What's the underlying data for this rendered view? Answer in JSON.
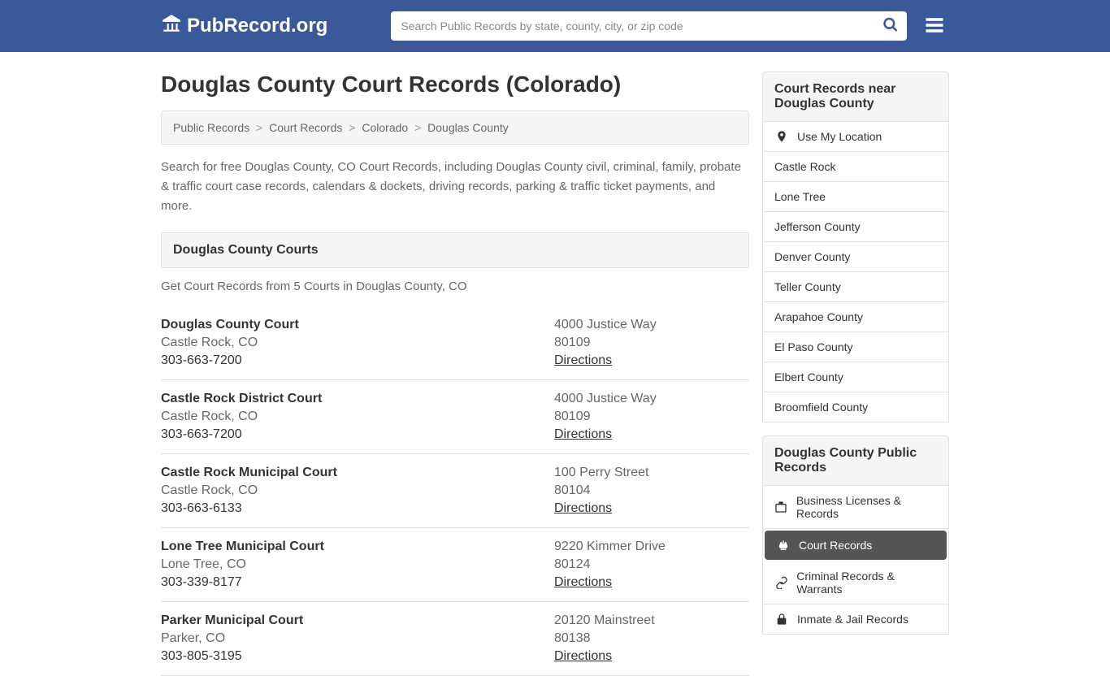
{
  "header": {
    "logo_text": "PubRecord.org",
    "search_placeholder": "Search Public Records by state, county, city, or zip code"
  },
  "page_title": "Douglas County Court Records (Colorado)",
  "breadcrumb": {
    "items": [
      "Public Records",
      "Court Records",
      "Colorado"
    ],
    "current": "Douglas County"
  },
  "intro": "Search for free Douglas County, CO Court Records, including Douglas County civil, criminal, family, probate & traffic court case records, calendars & dockets, driving records, parking & traffic ticket payments, and more.",
  "courts_section": {
    "header": "Douglas County Courts",
    "subtext": "Get Court Records from 5 Courts in Douglas County, CO",
    "directions_label": "Directions",
    "items": [
      {
        "name": "Douglas County Court",
        "location": "Castle Rock, CO",
        "phone": "303-663-7200",
        "address": "4000 Justice Way",
        "zip": "80109"
      },
      {
        "name": "Castle Rock District Court",
        "location": "Castle Rock, CO",
        "phone": "303-663-7200",
        "address": "4000 Justice Way",
        "zip": "80109"
      },
      {
        "name": "Castle Rock Municipal Court",
        "location": "Castle Rock, CO",
        "phone": "303-663-6133",
        "address": "100 Perry Street",
        "zip": "80104"
      },
      {
        "name": "Lone Tree Municipal Court",
        "location": "Lone Tree, CO",
        "phone": "303-339-8177",
        "address": "9220 Kimmer Drive",
        "zip": "80124"
      },
      {
        "name": "Parker Municipal Court",
        "location": "Parker, CO",
        "phone": "303-805-3195",
        "address": "20120 Mainstreet",
        "zip": "80138"
      }
    ]
  },
  "sidebar_near": {
    "header": "Court Records near Douglas County",
    "use_location": "Use My Location",
    "items": [
      "Castle Rock",
      "Lone Tree",
      "Jefferson County",
      "Denver County",
      "Teller County",
      "Arapahoe County",
      "El Paso County",
      "Elbert County",
      "Broomfield County"
    ]
  },
  "sidebar_public": {
    "header": "Douglas County Public Records",
    "items": [
      {
        "label": "Business Licenses & Records",
        "icon": "briefcase",
        "active": false
      },
      {
        "label": "Court Records",
        "icon": "scales",
        "active": true
      },
      {
        "label": "Criminal Records & Warrants",
        "icon": "link",
        "active": false
      },
      {
        "label": "Inmate & Jail Records",
        "icon": "lock",
        "active": false
      }
    ]
  }
}
